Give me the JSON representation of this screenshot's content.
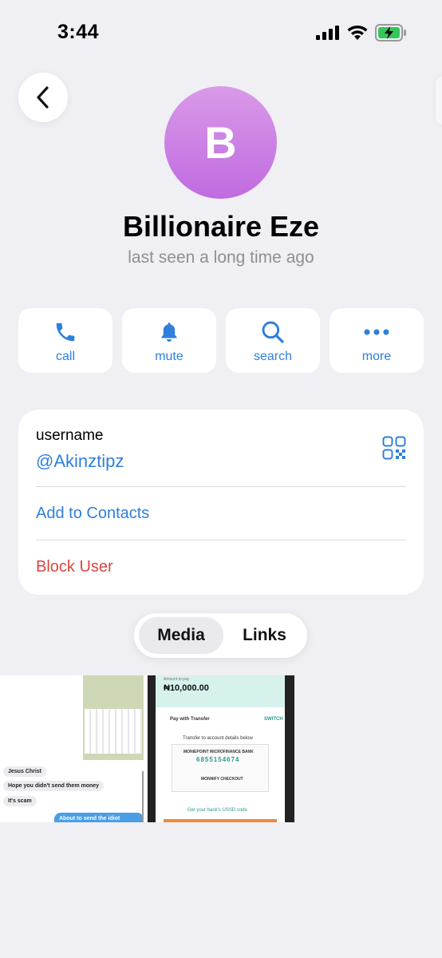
{
  "status_bar": {
    "time": "3:44"
  },
  "profile": {
    "avatar_initial": "B",
    "name": "Billionaire Eze",
    "last_seen": "last seen a long time ago"
  },
  "actions": [
    {
      "label": "call",
      "icon": "phone-icon"
    },
    {
      "label": "mute",
      "icon": "bell-icon"
    },
    {
      "label": "search",
      "icon": "search-icon"
    },
    {
      "label": "more",
      "icon": "more-icon"
    }
  ],
  "info": {
    "username_label": "username",
    "username_value": "@Akinztipz",
    "add_contacts": "Add to Contacts",
    "block_user": "Block User"
  },
  "segments": {
    "media": "Media",
    "links": "Links",
    "selected": "Media"
  },
  "thumbnails": {
    "t1": {
      "bubbles": [
        "Jesus Christ",
        "Hope you didn't send them money",
        "It's scam"
      ],
      "outgoing": "About to send the idiot money"
    },
    "t2": {
      "amount_label": "Amount to pay",
      "amount": "₦10,000.00",
      "pay_with": "Pay with Transfer",
      "switch": "SWITCH",
      "transfer_note": "Transfer to account details below",
      "bank": "MONIEPOINT MICROFINANCE BANK",
      "account": "6855154674",
      "account_name": "MONNIFY CHECKOUT",
      "ussd": "Get your bank's USSD code"
    }
  },
  "colors": {
    "accent": "#2f7fdc",
    "danger": "#d9473f",
    "avatar": "#c06be0"
  }
}
